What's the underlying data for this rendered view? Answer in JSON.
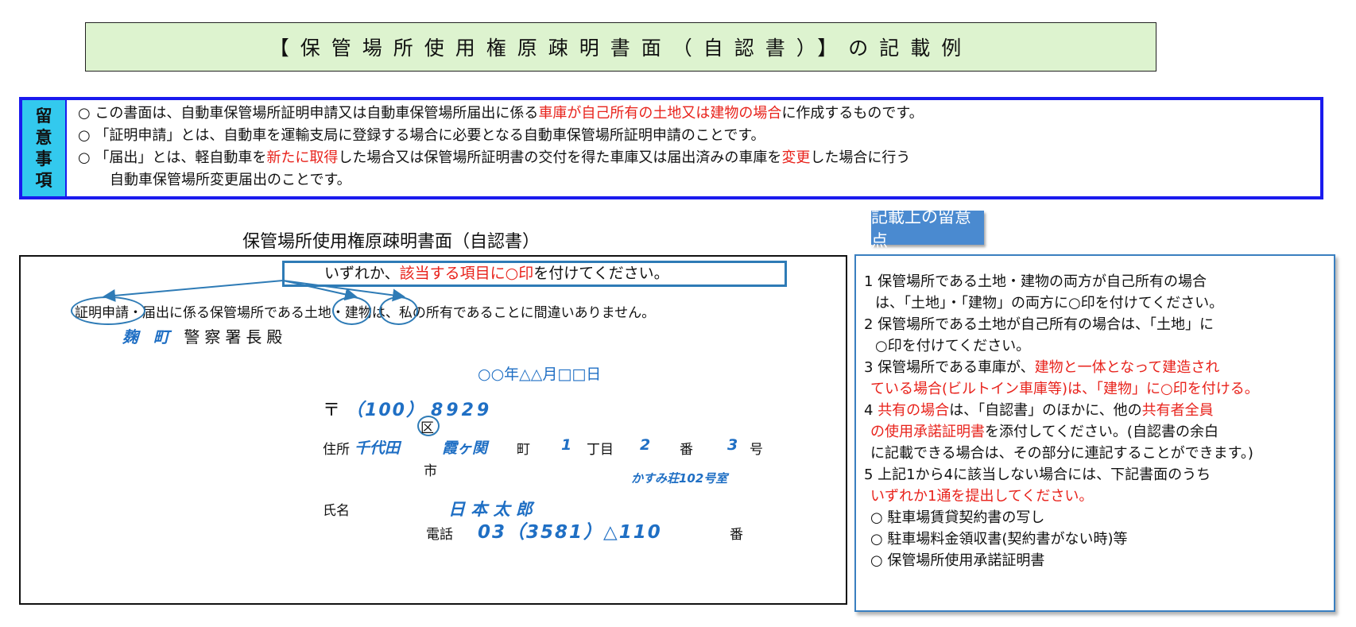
{
  "title": "【保管場所使用権原疎明書面（自認書）】の記載例",
  "notes": {
    "tag": [
      "留",
      "意",
      "事",
      "項"
    ],
    "line1": {
      "a": "○ この書面は、自動車保管場所証明申請又は自動車保管場所届出に係る",
      "b": "車庫が自己所有の土地又は建物の場合",
      "c": "に作成するものです。"
    },
    "line2": "○ 「証明申請」とは、自動車を運輸支局に登録する場合に必要となる自動車保管場所証明申請のことです。",
    "line3": {
      "a": "○ 「届出」とは、軽自動車を",
      "b": "新たに取得",
      "c": "した場合又は保管場所証明書の交付を得た車庫又は届出済みの車庫を",
      "d": "変更",
      "e": "した場合に行う"
    },
    "line4": "自動車保管場所変更届出のことです。"
  },
  "document": {
    "heading": "保管場所使用権原疎明書面（自認書）",
    "instruction": {
      "a": "いずれか、",
      "b": "該当する項目に○印",
      "c": "を付けてください。"
    },
    "statement": {
      "a": "証明申請",
      "b": "・届出に係る保管場所である",
      "c": "土地",
      "d": "・",
      "e": "建物",
      "f": "は、私の所有であることに間違いありません。"
    },
    "police": "麹 町",
    "police_suffix": "警察署長殿",
    "date": "○○年△△月□□日",
    "postal_mark": "〒",
    "postal_a": "（100）",
    "postal_b": "8929",
    "address_label": "住所",
    "ward_mark": "区",
    "city_mark": "市",
    "addr_city": "千代田",
    "addr_town": "霞ヶ関",
    "addr_machi": "町",
    "addr_chome_num": "1",
    "addr_chome": "丁目",
    "addr_ban_num": "2",
    "addr_ban": "番",
    "addr_go_num": "3",
    "addr_go": "号",
    "addr_building": "かすみ荘102号室",
    "name_label": "氏名",
    "name_value": "日 本 太 郎",
    "phone_label": "電話",
    "phone_value": "03（3581）△110",
    "phone_suffix": "番"
  },
  "points": {
    "label": "記載上の留意点",
    "p1a": "1 保管場所である土地・建物の両方が自己所有の場合",
    "p1b": "は、「土地」・「建物」の両方に○印を付けてください。",
    "p2a": "2 保管場所である土地が自己所有の場合は、「土地」に",
    "p2b": "○印を付けてください。",
    "p3a_1": "3 保管場所である車庫が、",
    "p3a_2": "建物と一体となって建造され",
    "p3b": "ている場合(ビルトイン車庫等)は、「建物」に○印を付ける。",
    "p4a_1": "4 ",
    "p4a_2": "共有の場合",
    "p4a_3": "は、「自認書」のほかに、他の",
    "p4a_4": "共有者全員",
    "p4b_1": "の使用承諾証明書",
    "p4b_2": "を添付してください。(自認書の余白",
    "p4c": "に記載できる場合は、その部分に連記することができます。)",
    "p5a": "5 上記1から4に該当しない場合には、下記書面のうち",
    "p5b": "いずれか1通を提出してください。",
    "opt1": "○ 駐車場賃貸契約書の写し",
    "opt2": "○ 駐車場料金領収書(契約書がない時)等",
    "opt3": "○ 保管場所使用承諾証明書"
  }
}
